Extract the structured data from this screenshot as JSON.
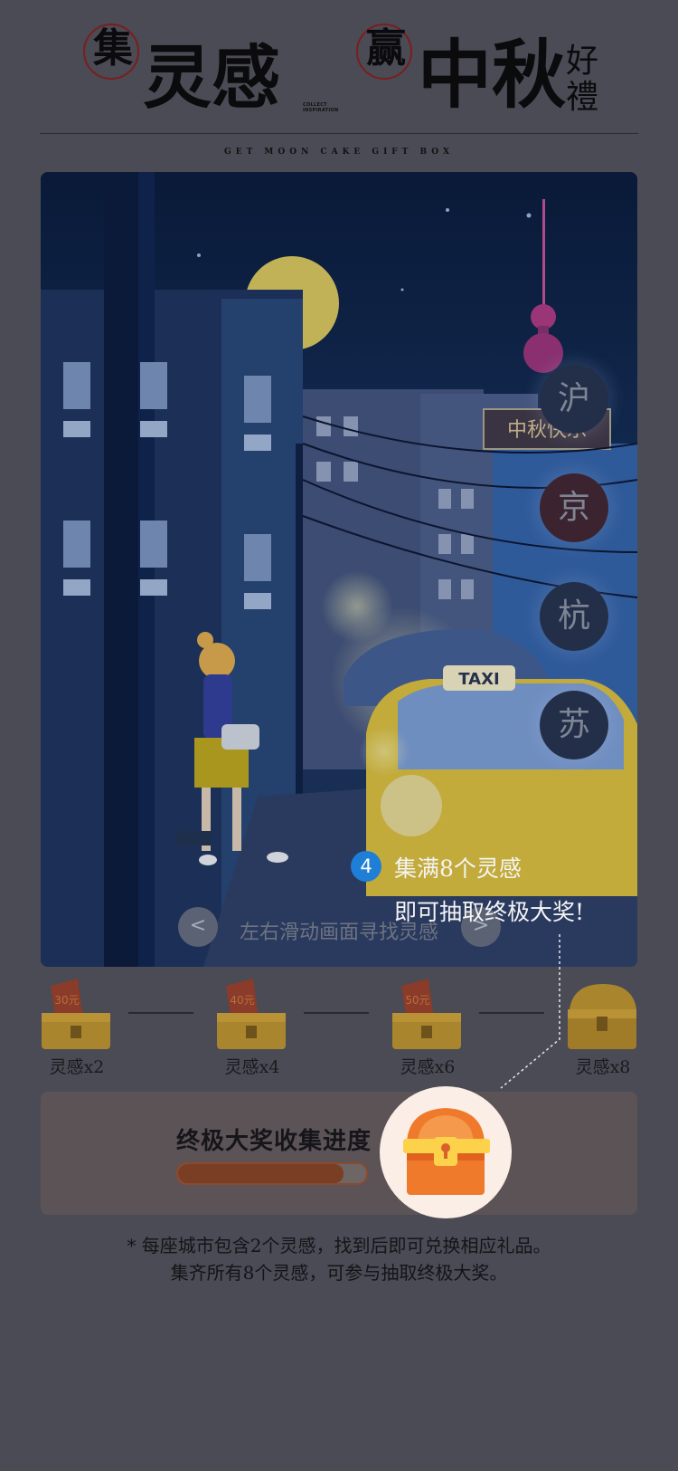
{
  "header": {
    "title_collect_seal": "集",
    "title_collect": "灵感",
    "collect_tiny": [
      "COLLECT",
      "INSPIRATION"
    ],
    "title_win_seal": "赢",
    "title_win": "中秋",
    "title_gift_top": "好",
    "title_gift_bottom": "禮",
    "subtitle": "GET MOON CAKE GIFT BOX"
  },
  "scene": {
    "cities": [
      "沪",
      "京",
      "杭",
      "苏"
    ],
    "taxi_sign": "TAXI",
    "neon_sign": "中秋快乐",
    "swipe_hint": "左右滑动画面寻找灵感",
    "prev_arrow": "<",
    "next_arrow": ">"
  },
  "guide": {
    "step": "4",
    "line1": "集满8个灵感",
    "line2": "即可抽取终极大奖!"
  },
  "rewards": [
    {
      "label": "灵感x2",
      "badge": "30元"
    },
    {
      "label": "灵感x4",
      "badge": "40元"
    },
    {
      "label": "灵感x6",
      "badge": "50元"
    },
    {
      "label": "灵感x8",
      "badge": ""
    }
  ],
  "progress": {
    "title": "终极大奖收集进度",
    "fraction": 0.88
  },
  "notes": {
    "line1": "* 每座城市包含2个灵感，找到后即可兑换相应礼品。",
    "line2": "集齐所有8个灵感，可参与抽取终极大奖。"
  },
  "colors": {
    "overlay": "#4a4b54",
    "accent_blue": "#1f7fd6",
    "chest_orange": "#f07a2c",
    "seal_red": "#7b1d20"
  }
}
